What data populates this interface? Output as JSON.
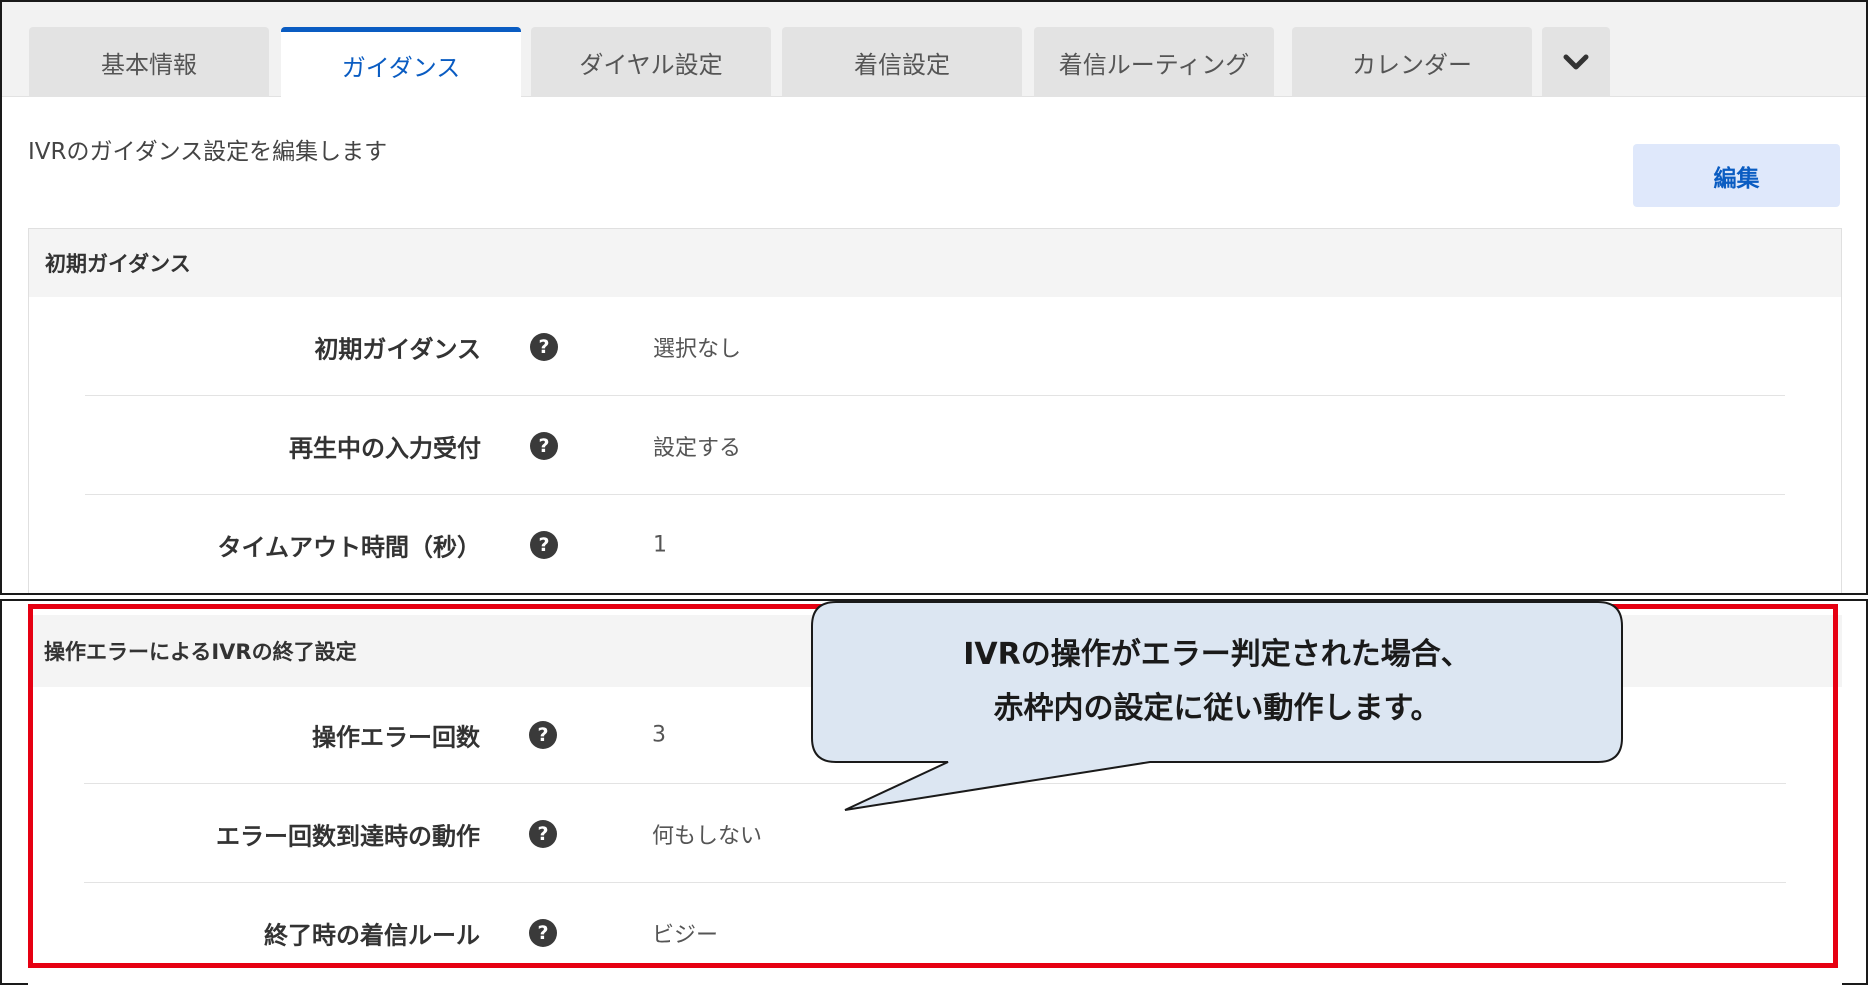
{
  "tabs": [
    {
      "label": "基本情報",
      "active": false
    },
    {
      "label": "ガイダンス",
      "active": true
    },
    {
      "label": "ダイヤル設定",
      "active": false
    },
    {
      "label": "着信設定",
      "active": false
    },
    {
      "label": "着信ルーティング",
      "active": false
    },
    {
      "label": "カレンダー",
      "active": false
    }
  ],
  "more_tabs_icon": "chevron-down-icon",
  "page": {
    "description": "IVRのガイダンス設定を編集します",
    "edit_label": "編集"
  },
  "initial_guidance": {
    "title": "初期ガイダンス",
    "rows": [
      {
        "label": "初期ガイダンス",
        "value": "選択なし"
      },
      {
        "label": "再生中の入力受付",
        "value": "設定する"
      },
      {
        "label": "タイムアウト時間（秒）",
        "value": "1"
      }
    ]
  },
  "error_settings": {
    "title": "操作エラーによるIVRの終了設定",
    "rows": [
      {
        "label": "操作エラー回数",
        "value": "3"
      },
      {
        "label": "エラー回数到達時の動作",
        "value": "何もしない"
      },
      {
        "label": "終了時の着信ルール",
        "value": "ビジー"
      }
    ]
  },
  "callout": {
    "line1": "IVRの操作がエラー判定された場合、",
    "line2": "赤枠内の設定に従い動作します。"
  },
  "help_icon_glyph": "?",
  "colors": {
    "accent": "#0a5cc2",
    "highlight_frame": "#e60012",
    "callout_fill": "#dce6f2"
  }
}
